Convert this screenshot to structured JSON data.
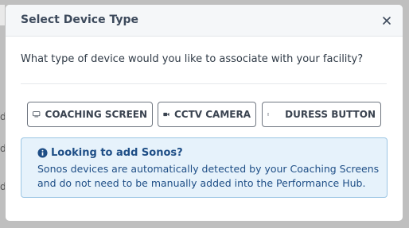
{
  "background": {
    "partial_letters": [
      "d",
      "d",
      "d"
    ]
  },
  "modal": {
    "title": "Select Device Type",
    "close_icon": "close-icon",
    "question": "What type of device would you like to associate with your facility?",
    "device_buttons": [
      {
        "label": "COACHING SCREEN",
        "icon": "monitor-icon"
      },
      {
        "label": "CCTV CAMERA",
        "icon": "video-camera-icon"
      },
      {
        "label": "DURESS BUTTON",
        "icon": "duress-button-icon"
      }
    ],
    "info_alert": {
      "icon": "info-circle-icon",
      "title": "Looking to add Sonos?",
      "line1": "Sonos devices are automatically detected by your Coaching Screens",
      "line2": "and do not need to be manually added into the Performance Hub."
    }
  },
  "colors": {
    "overlay": "#bfbfbf",
    "header_bg": "#f5f7f9",
    "info_bg": "#e6f2fb",
    "info_border": "#9cc6e4",
    "info_text": "#1e4e86",
    "button_border": "#6f7680"
  }
}
